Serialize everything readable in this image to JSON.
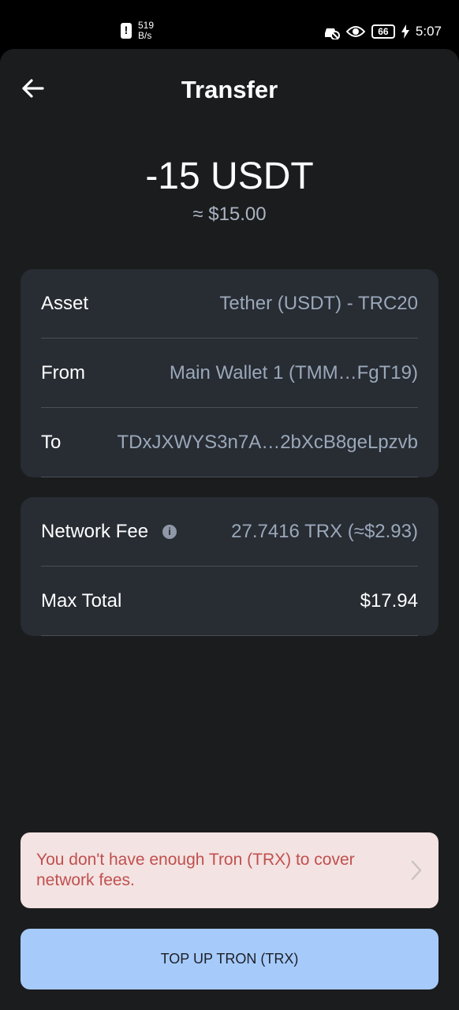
{
  "status_bar": {
    "speed_value": "519",
    "speed_unit": "B/s",
    "battery": "66",
    "time": "5:07"
  },
  "header": {
    "title": "Transfer",
    "back_icon": "arrow-left-icon"
  },
  "amount": {
    "value": "-15 USDT",
    "fiat": "≈ $15.00"
  },
  "details": [
    {
      "label": "Asset",
      "value": "Tether (USDT) - TRC20"
    },
    {
      "label": "From",
      "value": "Main Wallet 1  (TMM…FgT19)"
    },
    {
      "label": "To",
      "value": "TDxJXWYS3n7A…2bXcB8geLpzvb"
    }
  ],
  "fees": [
    {
      "label": "Network Fee",
      "value": "27.7416 TRX (≈$2.93)",
      "icon": "info-icon"
    },
    {
      "label": "Max Total",
      "value": "$17.94"
    }
  ],
  "warning": {
    "text": "You don't have enough Tron (TRX) to cover network fees.",
    "icon": "chevron-right-icon",
    "color": "#c0504f",
    "background": "#f3e3e2"
  },
  "action": {
    "label": "TOP UP TRON (TRX)",
    "color": "#a6cbfb"
  }
}
